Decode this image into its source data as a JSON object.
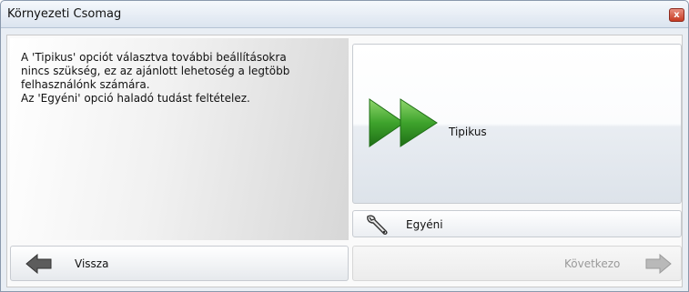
{
  "window": {
    "title": "Környezeti Csomag",
    "close_glyph": "x"
  },
  "description": {
    "text": "A 'Tipikus' opciót választva további beállításokra\nnincs szükség, ez az ajánlott lehetoség a legtöbb\nfelhasználónk számára.\nAz 'Egyéni' opció haladó tudást feltételez."
  },
  "options": {
    "tipikus": {
      "label": "Tipikus",
      "icon": "fast-forward-icon"
    },
    "egyeni": {
      "label": "Egyéni",
      "icon": "wrench-icon"
    }
  },
  "navigation": {
    "back": {
      "label": "Vissza",
      "icon": "arrow-left-icon"
    },
    "next": {
      "label": "Következo",
      "icon": "arrow-right-icon",
      "enabled": false
    }
  },
  "colors": {
    "accent_green": "#3ea32c",
    "close_red": "#c63a22",
    "disabled_text": "#9a9a9a"
  }
}
